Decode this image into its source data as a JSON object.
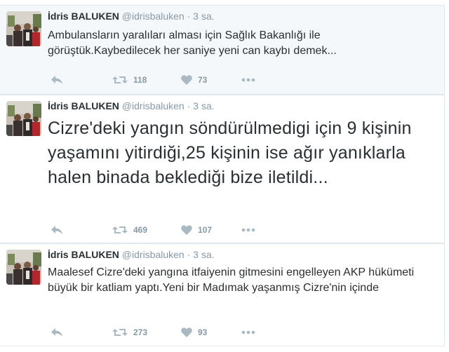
{
  "tweets": [
    {
      "fullname": "İdris BALUKEN",
      "screen_name": "@idrisbaluken",
      "dot": "·",
      "time": "3 sa.",
      "text": "Ambulansların yaralıları alması için Sağlık Bakanlığı ile görüştük.Kaybedilecek her saniye yeni can kaybı demek...",
      "retweets": "118",
      "likes": "73"
    },
    {
      "fullname": "İdris BALUKEN",
      "screen_name": "@idrisbaluken",
      "dot": "·",
      "time": "3 sa.",
      "text": "Cizre'deki yangın söndürülmedigi için 9 kişinin yaşamını yitirdiği,25 kişinin ise ağır yanıklarla halen binada beklediği bize iletildi...",
      "retweets": "469",
      "likes": "107"
    },
    {
      "fullname": "İdris BALUKEN",
      "screen_name": "@idrisbaluken",
      "dot": "·",
      "time": "3 sa.",
      "text": "Maalesef Cizre'deki yangına itfaiyenin gitmesini engelleyen AKP hükümeti büyük  bir katliam yaptı.Yeni bir Madımak yaşanmış Cizre'nin içinde",
      "retweets": "273",
      "likes": "93"
    }
  ],
  "icons": {
    "reply": "reply-arrow-icon",
    "retweet": "retweet-icon",
    "like": "heart-icon",
    "more": "more-dots-icon"
  },
  "colors": {
    "action_gray": "#aab8c2",
    "secondary_text": "#8899a6",
    "primary_text": "#292f33",
    "highlight_bg": "#f5f8fa"
  }
}
